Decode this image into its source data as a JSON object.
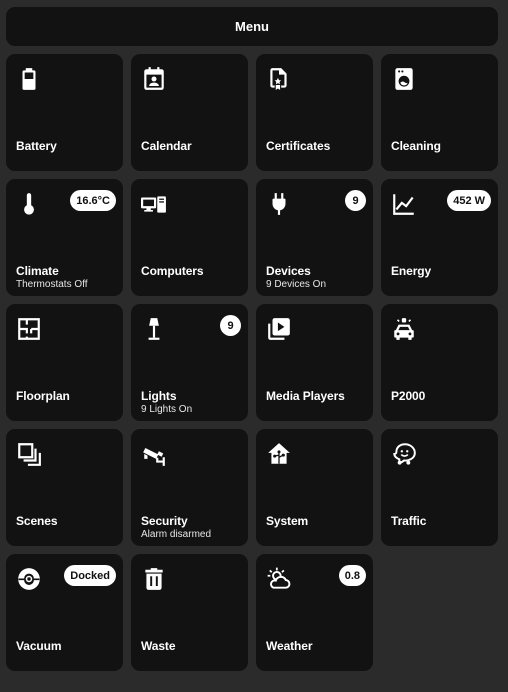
{
  "menu": {
    "label": "Menu"
  },
  "tiles": [
    {
      "name": "Battery",
      "sub": "",
      "badge": "",
      "icon": "battery-icon"
    },
    {
      "name": "Calendar",
      "sub": "",
      "badge": "",
      "icon": "calendar-account-icon"
    },
    {
      "name": "Certificates",
      "sub": "",
      "badge": "",
      "icon": "certificate-icon"
    },
    {
      "name": "Cleaning",
      "sub": "",
      "badge": "",
      "icon": "washing-machine-icon"
    },
    {
      "name": "Climate",
      "sub": "Thermostats Off",
      "badge": "16.6°C",
      "icon": "thermometer-icon"
    },
    {
      "name": "Computers",
      "sub": "",
      "badge": "",
      "icon": "desktop-tower-monitor-icon"
    },
    {
      "name": "Devices",
      "sub": "9 Devices On",
      "badge": "9",
      "icon": "power-plug-icon"
    },
    {
      "name": "Energy",
      "sub": "",
      "badge": "452 W",
      "icon": "chart-line-icon"
    },
    {
      "name": "Floorplan",
      "sub": "",
      "badge": "",
      "icon": "floor-plan-icon"
    },
    {
      "name": "Lights",
      "sub": "9 Lights On",
      "badge": "9",
      "icon": "floor-lamp-icon"
    },
    {
      "name": "Media Players",
      "sub": "",
      "badge": "",
      "icon": "play-box-multiple-icon"
    },
    {
      "name": "P2000",
      "sub": "",
      "badge": "",
      "icon": "car-emergency-icon"
    },
    {
      "name": "Scenes",
      "sub": "",
      "badge": "",
      "icon": "scenes-squares-icon"
    },
    {
      "name": "Security",
      "sub": "Alarm disarmed",
      "badge": "",
      "icon": "cctv-icon"
    },
    {
      "name": "System",
      "sub": "",
      "badge": "",
      "icon": "home-network-icon"
    },
    {
      "name": "Traffic",
      "sub": "",
      "badge": "",
      "icon": "waze-icon"
    },
    {
      "name": "Vacuum",
      "sub": "",
      "badge": "Docked",
      "icon": "robot-vacuum-icon"
    },
    {
      "name": "Waste",
      "sub": "",
      "badge": "",
      "icon": "trash-can-icon"
    },
    {
      "name": "Weather",
      "sub": "",
      "badge": "0.8",
      "icon": "weather-partly-cloudy-icon"
    }
  ]
}
